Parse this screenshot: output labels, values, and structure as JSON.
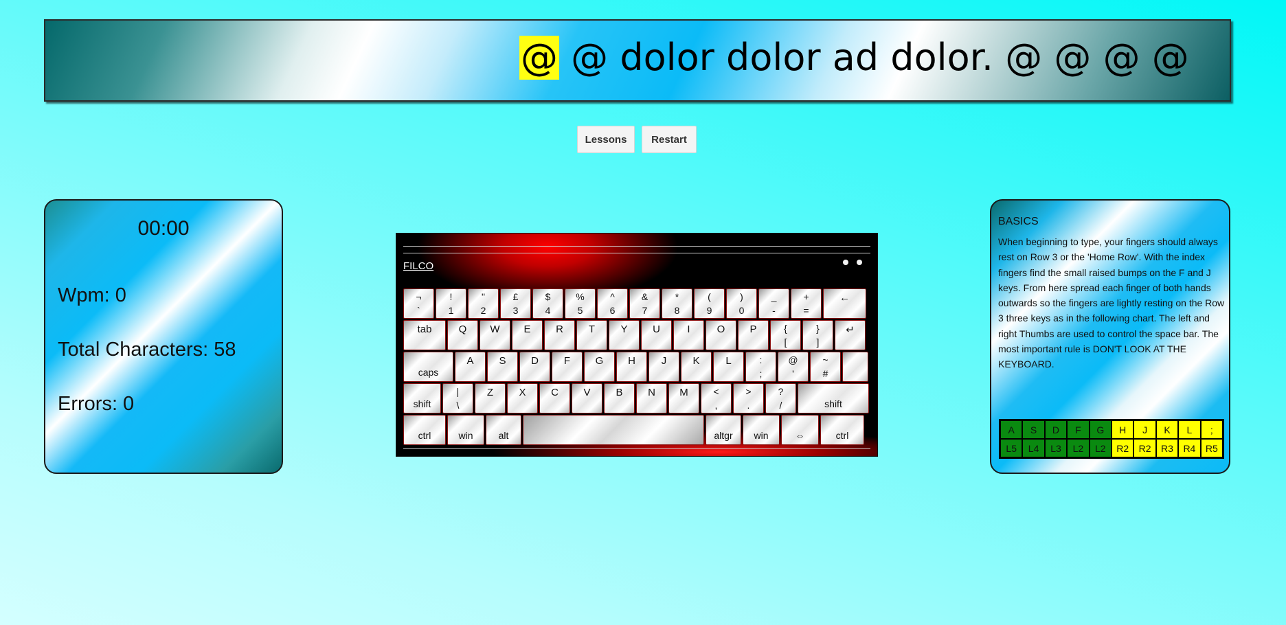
{
  "banner": {
    "current_char": "@",
    "remaining_text": " @ dolor dolor ad dolor. @ @ @ @"
  },
  "buttons": {
    "lessons": "Lessons",
    "restart": "Restart"
  },
  "stats": {
    "timer": "00:00",
    "wpm": "Wpm: 0",
    "total_characters": "Total Characters: 58",
    "errors": "Errors: 0"
  },
  "keyboard": {
    "brand": "FILCO",
    "rows": [
      [
        {
          "top": "¬",
          "bottom": "`"
        },
        {
          "top": "!",
          "bottom": "1"
        },
        {
          "top": "\"",
          "bottom": "2"
        },
        {
          "top": "£",
          "bottom": "3"
        },
        {
          "top": "$",
          "bottom": "4"
        },
        {
          "top": "%",
          "bottom": "5"
        },
        {
          "top": "^",
          "bottom": "6"
        },
        {
          "top": "&",
          "bottom": "7"
        },
        {
          "top": "*",
          "bottom": "8"
        },
        {
          "top": "(",
          "bottom": "9"
        },
        {
          "top": ")",
          "bottom": "0"
        },
        {
          "top": "_",
          "bottom": "-"
        },
        {
          "top": "+",
          "bottom": "="
        },
        {
          "label": "←"
        }
      ],
      [
        {
          "label": "tab"
        },
        {
          "label": "Q"
        },
        {
          "label": "W"
        },
        {
          "label": "E"
        },
        {
          "label": "R"
        },
        {
          "label": "T"
        },
        {
          "label": "Y"
        },
        {
          "label": "U"
        },
        {
          "label": "I"
        },
        {
          "label": "O"
        },
        {
          "label": "P"
        },
        {
          "top": "{",
          "bottom": "["
        },
        {
          "top": "}",
          "bottom": "]"
        },
        {
          "label": "↵"
        }
      ],
      [
        {
          "low": "caps"
        },
        {
          "label": "A"
        },
        {
          "label": "S"
        },
        {
          "label": "D"
        },
        {
          "label": "F"
        },
        {
          "label": "G"
        },
        {
          "label": "H"
        },
        {
          "label": "J"
        },
        {
          "label": "K"
        },
        {
          "label": "L"
        },
        {
          "top": ":",
          "bottom": ";"
        },
        {
          "top": "@",
          "bottom": "'"
        },
        {
          "top": "~",
          "bottom": "#"
        },
        {
          "label": ""
        }
      ],
      [
        {
          "low": "shift"
        },
        {
          "top": "|",
          "bottom": "\\"
        },
        {
          "label": "Z"
        },
        {
          "label": "X"
        },
        {
          "label": "C"
        },
        {
          "label": "V"
        },
        {
          "label": "B"
        },
        {
          "label": "N"
        },
        {
          "label": "M"
        },
        {
          "top": "<",
          "bottom": ","
        },
        {
          "top": ">",
          "bottom": "."
        },
        {
          "top": "?",
          "bottom": "/"
        },
        {
          "low": "shift"
        }
      ],
      [
        {
          "low": "ctrl"
        },
        {
          "low": "win"
        },
        {
          "low": "alt"
        },
        {
          "low": ""
        },
        {
          "low": "altgr"
        },
        {
          "low": "win"
        },
        {
          "low": "⇔"
        },
        {
          "low": "ctrl"
        }
      ]
    ]
  },
  "lesson": {
    "title": "BASICS",
    "body": "When beginning to type, your fingers should always rest on Row 3 or the 'Home Row'. With the index fingers find the small raised bumps on the F and J keys. From here spread each finger of both hands outwards so the fingers are lightly resting on the Row 3 three keys as in the following chart. The left and right Thumbs are used to control the space bar. The most important rule is DON'T LOOK AT THE KEYBOARD.",
    "chart": {
      "keys": [
        "A",
        "S",
        "D",
        "F",
        "G",
        "H",
        "J",
        "K",
        "L",
        ";"
      ],
      "fingers": [
        "L5",
        "L4",
        "L3",
        "L2",
        "L2",
        "R2",
        "R2",
        "R3",
        "R4",
        "R5"
      ],
      "left_color": "#0a8a10",
      "right_color": "#ffff00"
    }
  }
}
